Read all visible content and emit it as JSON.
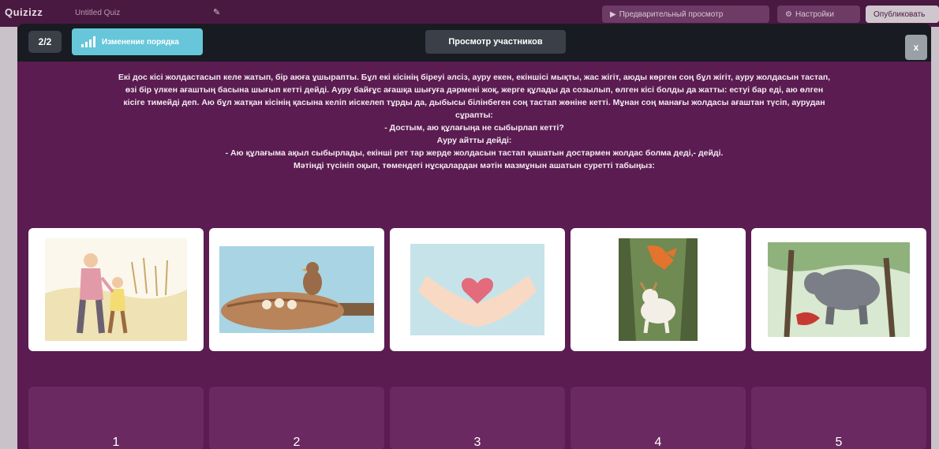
{
  "app": {
    "logo": "Quizizz",
    "quiz_title": "Untitled Quiz",
    "preview_label": "Предварительный просмотр",
    "settings_label": "Настройки",
    "publish_label": "Опубликовать"
  },
  "modal": {
    "counter": "2/2",
    "reorder_label": "Изменение порядка",
    "participants_label": "Просмотр участников",
    "close_label": "x",
    "question_lines": [
      "Екі дос кісі жолдастасып келе жатып, бір аюға ұшырапты. Бұл екі кісінің біреуі әлсіз, ауру екен, екіншісі мықты, жас жігіт, аюды көрген соң бұл жігіт, ауру жолдасын тастап,",
      "өзі бір үлкен ағаштың басына шығып кетті дейді. Ауру байғұс ағашқа шығуға дәрмені жоқ, жерге құлады да созылып, өлген кісі болды да жатты: естуі бар еді, аю өлген",
      "кісіге тимейді деп. Аю бұл жатқан кісінің қасына келіп иіскелеп тұрды да, дыбысы білінбеген соң тастап жөніне кетті. Мұнан соң манағы жолдасы ағаштан түсіп, аурудан",
      "сұрапты:",
      "- Достым, аю құлағыңа не сыбырлап кетті?",
      "Ауру айтты дейді:",
      "- Аю құлағыма ақыл сыбырлады, екінші рет тар жерде жолдасын тастап қашатын достармен жолдас болма деді,- дейді.",
      "Мәтінді түсініп оқып, төмендегі нұсқалардан мәтін мазмұнын ашатын суретті табыңыз:"
    ],
    "cards": [
      {
        "icon": "father-son-walking-icon"
      },
      {
        "icon": "bird-nest-icon"
      },
      {
        "icon": "hands-heart-icon"
      },
      {
        "icon": "fox-goat-well-icon"
      },
      {
        "icon": "bear-man-forest-icon"
      }
    ],
    "slots": [
      "1",
      "2",
      "3",
      "4",
      "5"
    ]
  },
  "colors": {
    "modal_bg": "#5b1c52",
    "header_bg": "#181b21",
    "reorder_accent": "#67c6da",
    "slot_bg": "#6a2960"
  }
}
